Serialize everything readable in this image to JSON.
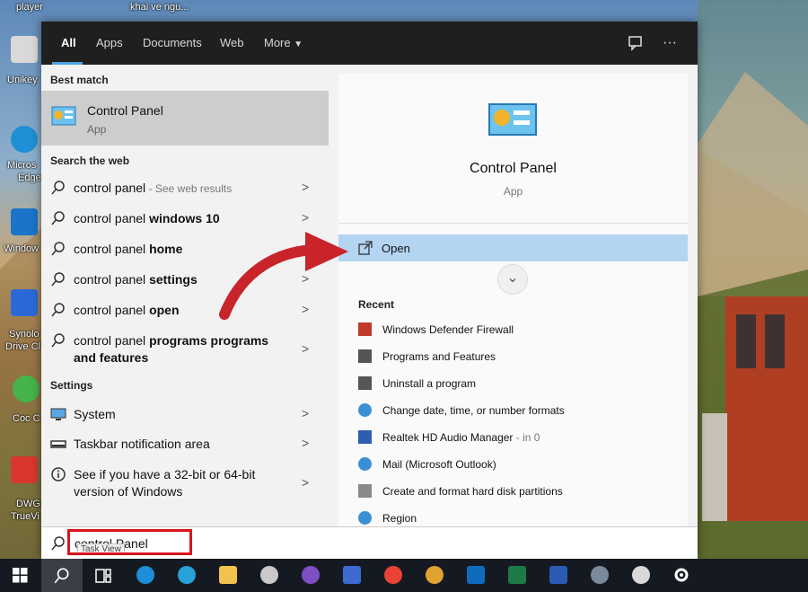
{
  "desktop": {
    "labels": [
      "player",
      "khai ve ngu...",
      "Unikey",
      "Micros",
      "Edge",
      "Window",
      "Synolo",
      "Drive Cl",
      "Coc C",
      "DWG",
      "TrueVi"
    ]
  },
  "tabs": [
    "All",
    "Apps",
    "Documents",
    "Web",
    "More"
  ],
  "topbar": {
    "feedback_icon": "feedback-icon",
    "more_icon": "ellipsis-icon"
  },
  "left": {
    "best_match_heading": "Best match",
    "best_match": {
      "title": "Control Panel",
      "subtitle": "App"
    },
    "web_heading": "Search the web",
    "web_results": [
      {
        "prefix": "control panel",
        "bold": "",
        "hint": " - See web results"
      },
      {
        "prefix": "control panel ",
        "bold": "windows 10",
        "hint": ""
      },
      {
        "prefix": "control panel ",
        "bold": "home",
        "hint": ""
      },
      {
        "prefix": "control panel ",
        "bold": "settings",
        "hint": ""
      },
      {
        "prefix": "control panel ",
        "bold": "open",
        "hint": ""
      },
      {
        "prefix": "control panel ",
        "bold": "programs programs",
        "line2": "and features",
        "hint": ""
      }
    ],
    "settings_heading": "Settings",
    "settings_results": [
      {
        "text": "System"
      },
      {
        "text": "Taskbar notification area"
      },
      {
        "text": "See if you have a 32-bit or 64-bit",
        "line2": "version of Windows"
      }
    ]
  },
  "right": {
    "title": "Control Panel",
    "subtitle": "App",
    "open_label": "Open",
    "recent_heading": "Recent",
    "recent": [
      {
        "text": "Windows Defender Firewall",
        "hint": ""
      },
      {
        "text": "Programs and Features",
        "hint": ""
      },
      {
        "text": "Uninstall a program",
        "hint": ""
      },
      {
        "text": "Change date, time, or number formats",
        "hint": ""
      },
      {
        "text": "Realtek HD Audio Manager",
        "hint": " - in 0"
      },
      {
        "text": "Mail (Microsoft Outlook)",
        "hint": ""
      },
      {
        "text": "Create and format hard disk partitions",
        "hint": ""
      },
      {
        "text": "Region",
        "hint": ""
      }
    ]
  },
  "search": {
    "value": "control Panel",
    "tooltip": "Task View"
  },
  "colors": {
    "accent": "#4ba3e0",
    "annotation": "#d8151b",
    "selection": "#b3d5f2"
  }
}
